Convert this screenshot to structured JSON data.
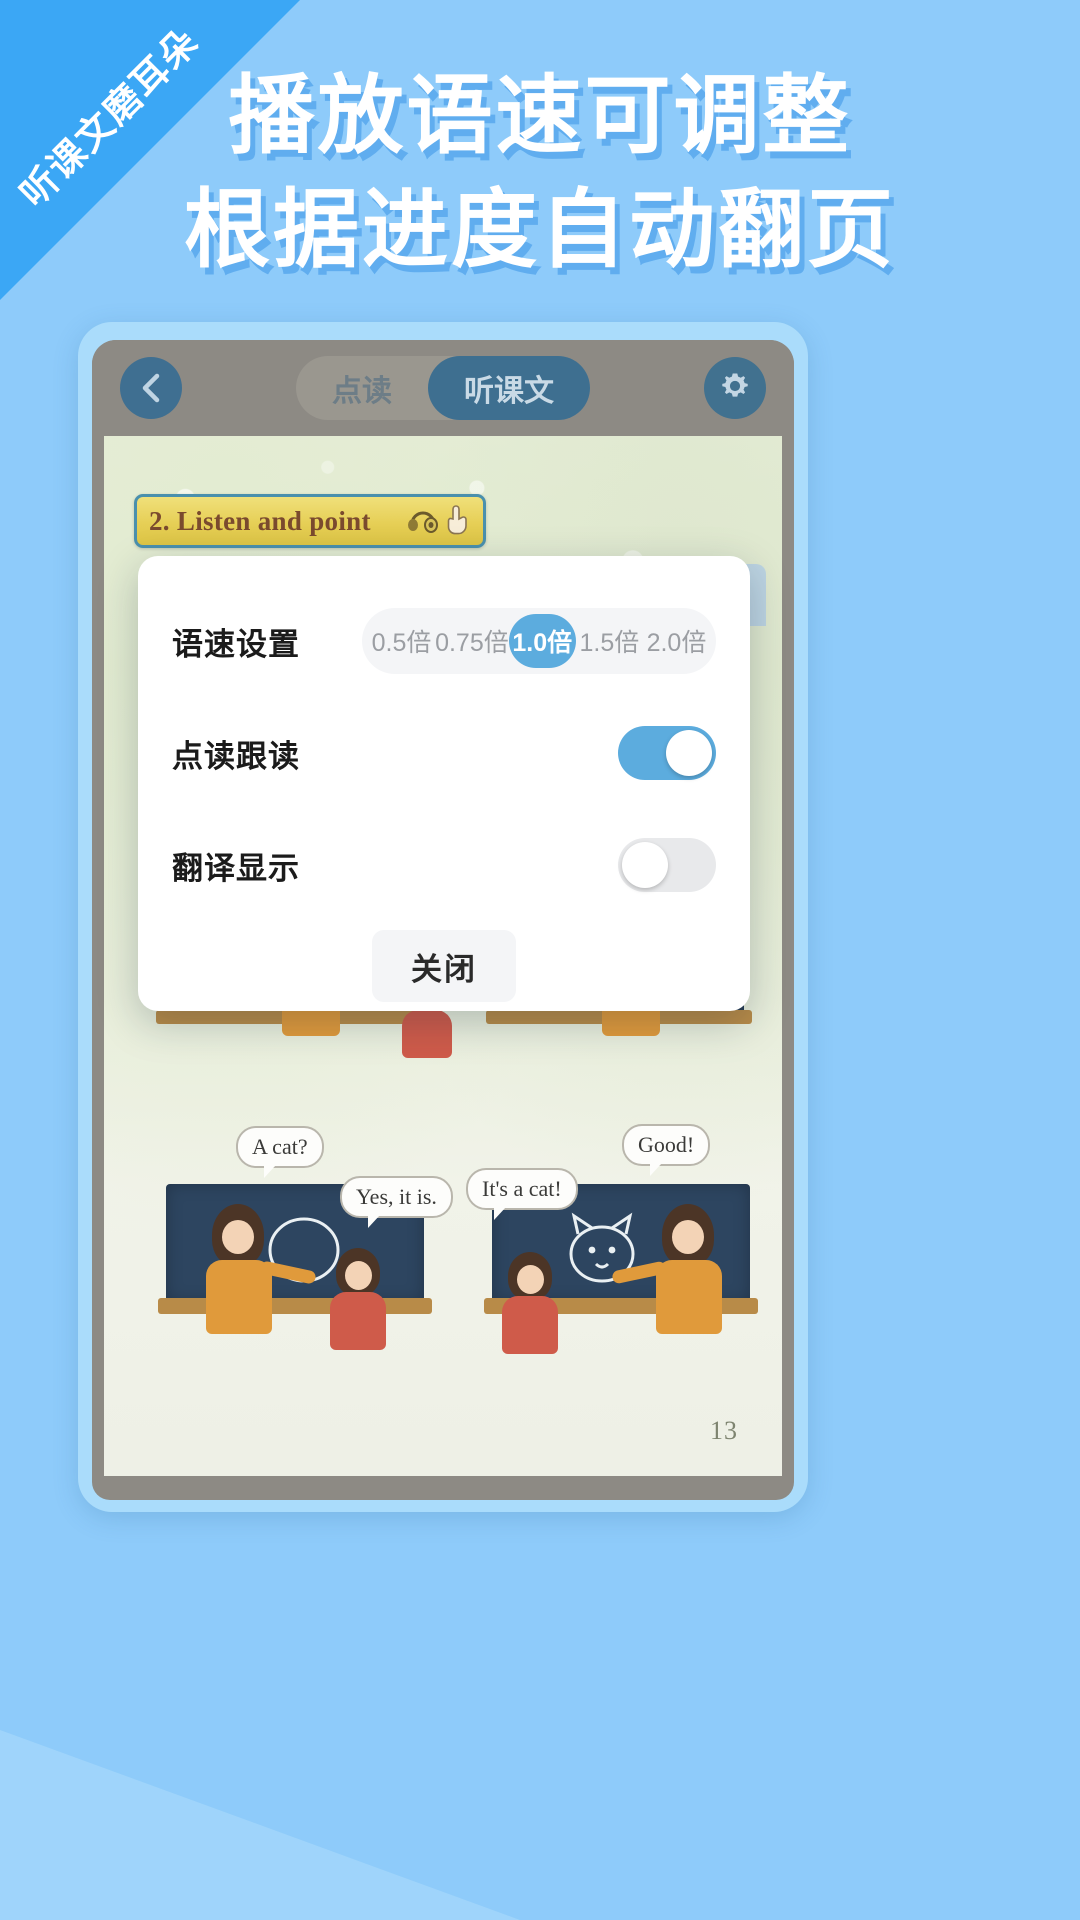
{
  "ribbon": {
    "text": "听课文磨耳朵"
  },
  "headline": {
    "line1": "播放语速可调整",
    "line2": "根据进度自动翻页"
  },
  "app": {
    "topbar": {
      "back_icon": "chevron-left-icon",
      "settings_icon": "gear-icon",
      "tabs": [
        {
          "label": "点读",
          "active": false
        },
        {
          "label": "听课文",
          "active": true
        }
      ]
    },
    "book_page": {
      "lesson_title": "2. Listen and point",
      "lesson_icons": [
        "headphones-icon",
        "pointing-hand-icon"
      ],
      "page_number": "13",
      "speech_bubbles": [
        "A cat?",
        "Yes, it is.",
        "It's a cat!",
        "Good!"
      ]
    }
  },
  "dialog": {
    "speed": {
      "label": "语速设置",
      "options": [
        "0.5倍",
        "0.75倍",
        "1.0倍",
        "1.5倍",
        "2.0倍"
      ],
      "selected": "1.0倍"
    },
    "follow_read": {
      "label": "点读跟读",
      "state": "on"
    },
    "translation": {
      "label": "翻译显示",
      "state": "off"
    },
    "close_label": "关闭"
  },
  "colors": {
    "background": "#8ecbfa",
    "ribbon": "#3ba7f5",
    "accent": "#5cacde",
    "headline_text": "#ffffff",
    "phone_frame": "#aadcfb",
    "phone_screen": "#8d8a84",
    "switch_on": "#5cacde",
    "switch_off": "#e8e9eb"
  }
}
